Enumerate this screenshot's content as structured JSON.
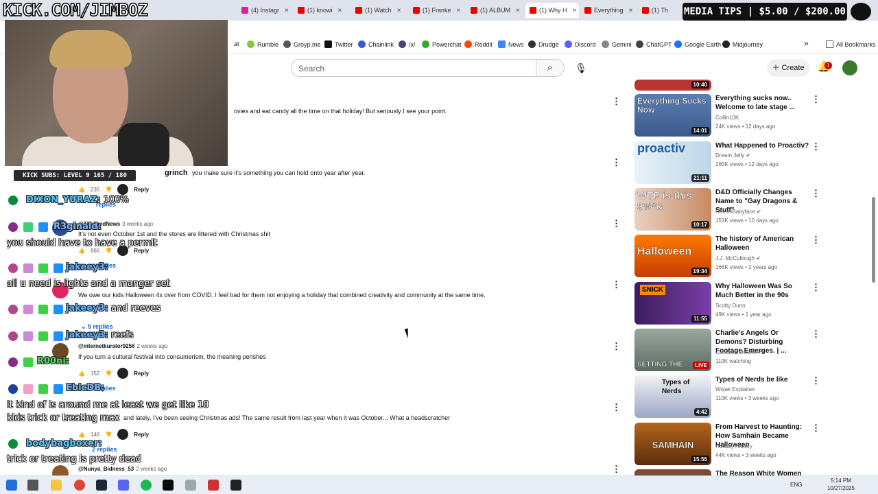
{
  "browser": {
    "tabs": [
      {
        "label": "(4) Instagr"
      },
      {
        "label": "(1) knowi"
      },
      {
        "label": "(1) Watch"
      },
      {
        "label": "(1) Franke"
      },
      {
        "label": "(1) ALBUM"
      },
      {
        "label": "(1) Why H"
      },
      {
        "label": "Everything"
      },
      {
        "label": "(1) Th"
      }
    ],
    "tab_close": "×",
    "bookmarks": [
      {
        "label": "at"
      },
      {
        "label": "Rumble"
      },
      {
        "label": "Groyp.me"
      },
      {
        "label": "Twitter"
      },
      {
        "label": "Chainlink"
      },
      {
        "label": "/x/"
      },
      {
        "label": "Powerchat"
      },
      {
        "label": "Reddit"
      },
      {
        "label": "News"
      },
      {
        "label": "Drudge"
      },
      {
        "label": "Discord"
      },
      {
        "label": "Gemini"
      },
      {
        "label": "ChatGPT"
      },
      {
        "label": "Google Earth"
      },
      {
        "label": "Midjourney"
      }
    ],
    "bookmarks_more": "»",
    "all_bookmarks": "All Bookmarks"
  },
  "overlay": {
    "kick_logo": "KICK.COM/JIMBOZ",
    "media_tips": "MEDIA TIPS | $5.00 / $200.00",
    "kick_subs": "KICK SUBS: LEVEL 9 165 / 180",
    "chat": [
      {
        "name": "DIXON_YURAZ:",
        "text": "100%"
      },
      {
        "name": "R3ginald:",
        "text": ""
      },
      {
        "name": "",
        "text": "you should have to have a permit"
      },
      {
        "name": "jakeey3:",
        "text": ""
      },
      {
        "name": "",
        "text": "all u need is lights and a manger set"
      },
      {
        "name": "jakeey3:",
        "text": "and reeves"
      },
      {
        "name": "jakeey3:",
        "text": "reefs"
      },
      {
        "name": "R00ni:",
        "text": ""
      },
      {
        "name": "EbicDB:",
        "text": ""
      },
      {
        "name": "",
        "text": "it kind of is around me at least we get like 10"
      },
      {
        "name": "",
        "text": "kids trick or treating max"
      },
      {
        "name": "bodybagboxer:",
        "text": ""
      },
      {
        "name": "",
        "text": "trick or treating is pretty dead"
      }
    ]
  },
  "youtube": {
    "search_placeholder": "Search",
    "create_label": "Create",
    "notif_count": "1",
    "comments": [
      {
        "text": "ovies and eat candy all the time on that holiday! But seriously I see your point."
      },
      {
        "author": "grinch",
        "text": "you make sure it's something you can hold onto year after year.",
        "likes": "235",
        "reply": "Reply",
        "replies": "replies"
      },
      {
        "author": "@TheHardNews",
        "ago": "3 weeks ago",
        "text": "It's not even October 1st and the stores are littered with Christmas shit",
        "likes": "866",
        "reply": "Reply",
        "replies": "replies"
      },
      {
        "text": "We owe our kids Halloween 4x over from COVID. I feel bad for them not enjoying a holiday that combined creativity and community at the same time.",
        "replies": "5 replies"
      },
      {
        "author": "@internetkurator9256",
        "ago": "2 weeks ago",
        "text": "If you turn a cultural festival into consumerism, the meaning perishes",
        "likes": "152",
        "reply": "Reply",
        "replies": "plies"
      },
      {
        "text": "and lately, I've been seeing Christmas ads! The same result from last year when it was October... What a headscratcher",
        "likes": "146",
        "reply": "Reply",
        "replies": "2 replies"
      },
      {
        "author": "@Nunya_Bidness_53",
        "ago": "2 weeks ago"
      }
    ],
    "sidebar": [
      {
        "duration": "10:40"
      },
      {
        "thumb_text": "Everything Sucks Now",
        "duration": "14:01",
        "title": "Everything sucks now.. Welcome to late stage ...",
        "channel": "Collin10K",
        "meta": "24K views • 12 days ago"
      },
      {
        "thumb_text": "proactiv",
        "duration": "21:11",
        "title": "What Happened to Proactiv?",
        "channel": "Dream Jelly",
        "meta": "265K views • 12 days ago"
      },
      {
        "thumb_text": "WTF is this $%*&",
        "duration": "10:17",
        "title": "D&D Officially Changes Name to \"Gay Dragons & Stuff\"",
        "channel": "HeelvsBabyface",
        "meta": "151K views • 10 days ago"
      },
      {
        "thumb_text": "Halloween",
        "duration": "19:34",
        "title": "The history of American Halloween",
        "channel": "J.J. McCullough",
        "meta": "166K views • 2 years ago"
      },
      {
        "thumb_text": "SNICK",
        "duration": "11:55",
        "title": "Why Halloween Was So Much Better in the 90s",
        "channel": "Scotty Dunn",
        "meta": "49K views • 1 year ago"
      },
      {
        "thumb_text": "SETTING THE",
        "duration": "LIVE",
        "title": "Charlie's Angels Or Demons? Disturbing Footage Emerges. | ...",
        "channel": "Candace Owens",
        "meta": "110K watching"
      },
      {
        "thumb_text": "Types of Nerds",
        "duration": "4:42",
        "title": "Types of Nerds be like",
        "channel": "Wojak Explainer",
        "meta": "110K views • 3 weeks ago"
      },
      {
        "thumb_text": "SAMHAIN",
        "duration": "15:55",
        "title": "From Harvest to Haunting: How Samhain Became Halloween",
        "channel": "Holiday History",
        "meta": "44K views • 3 weeks ago"
      },
      {
        "title": "The Reason White Women Vote"
      }
    ]
  },
  "taskbar": {
    "lang": "ENG",
    "time": "5:14 PM",
    "date": "10/27/2025"
  },
  "colors": {
    "youtube_red": "#ff0000",
    "link_blue": "#065fd4",
    "kick_green": "#53fc18"
  }
}
